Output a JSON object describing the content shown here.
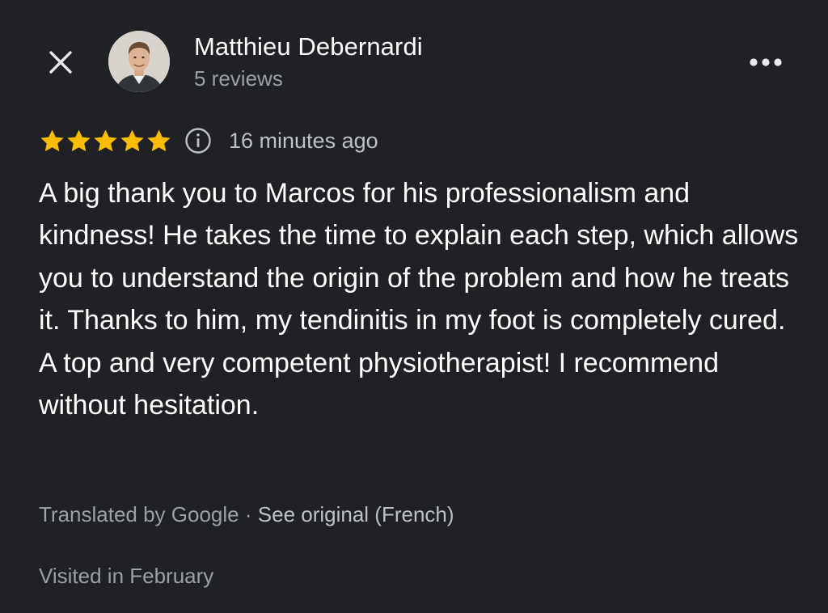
{
  "header": {
    "close_icon": "close-icon",
    "more_icon": "more-horizontal-icon",
    "author": {
      "name": "Matthieu Debernardi",
      "reviews": "5 reviews",
      "avatar": "avatar-photo"
    }
  },
  "review": {
    "rating": 5,
    "rating_max": 5,
    "star_color": "#FBBC04",
    "info_icon": "info-icon",
    "time_ago": "16 minutes ago",
    "text": "A big thank you to Marcos for his professionalism and kindness! He takes the time to explain each step, which allows you to understand the origin of the problem and how he treats it. Thanks to him, my tendinitis in my foot is completely cured. A top and very competent physiotherapist! I recommend without hesitation."
  },
  "translation": {
    "label": "Translated by Google",
    "separator": "·",
    "see_original": "See original (French)"
  },
  "visited": "Visited in February",
  "colors": {
    "background": "#202124",
    "primary_text": "#FFFFFF",
    "secondary_text": "#9AA0A6"
  }
}
